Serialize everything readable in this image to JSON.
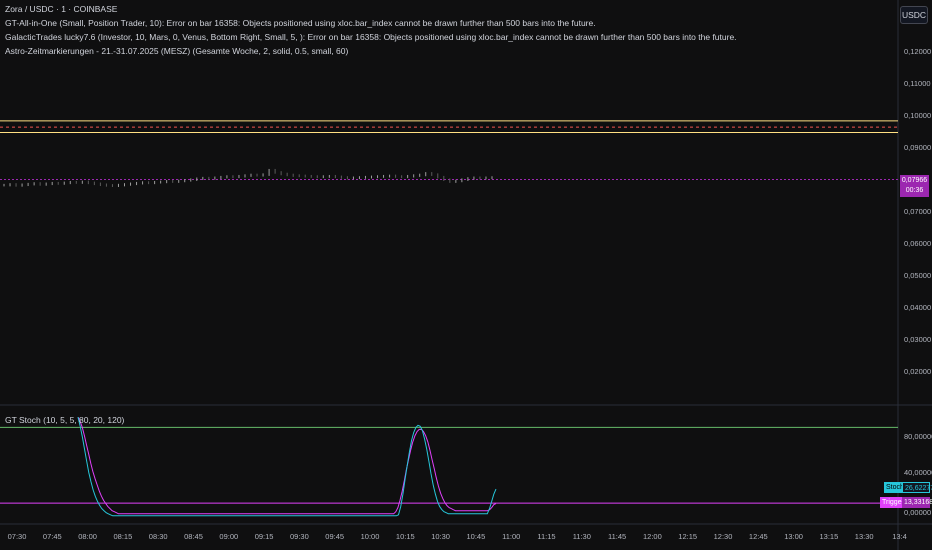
{
  "header": {
    "symbol_line": "Zora / USDC · 1 · COINBASE",
    "info_lines": [
      "GT-All-in-One (Small, Position Trader, 10): Error on bar 16358: Objects positioned using xloc.bar_index cannot be drawn further than 500 bars into the future.",
      "GalacticTrades lucky7.6 (Investor, 10, Mars, 0, Venus, Bottom Right, Small, 5, ): Error on bar 16358: Objects positioned using xloc.bar_index cannot be drawn further than 500 bars into the future.",
      "Astro-Zeitmarkierungen - 21.-31.07.2025 (MESZ) (Gesamte Woche, 2, solid, 0.5, small, 60)"
    ]
  },
  "currency_button": "USDC",
  "price_axis": {
    "labels": [
      "0,12000",
      "0,11000",
      "0,10000",
      "0,09000",
      "0,08000",
      "0,07000",
      "0,06000",
      "0,05000",
      "0,04000",
      "0,03000",
      "0,02000"
    ],
    "current_price": "0,07966",
    "countdown": "00:36"
  },
  "time_axis": {
    "labels": [
      "07:30",
      "07:45",
      "08:00",
      "08:15",
      "08:30",
      "08:45",
      "09:00",
      "09:15",
      "09:30",
      "09:45",
      "10:00",
      "10:15",
      "10:30",
      "10:45",
      "11:00",
      "11:15",
      "11:30",
      "11:45",
      "12:00",
      "12:15",
      "12:30",
      "12:45",
      "13:00",
      "13:15",
      "13:30",
      "13:4"
    ]
  },
  "indicator": {
    "title": "GT Stoch (10, 5, 5, 80, 20, 120)",
    "axis_labels": [
      "80,00000",
      "40,00000",
      "0,00000"
    ],
    "stoch_label": "Stoch",
    "stoch_value": "26,62277",
    "trigger_label": "Trigger",
    "trigger_value": "13,33168"
  },
  "colors": {
    "background": "#0f0f10",
    "upper_level": "#ffe082",
    "dashed_level": "#ef5350",
    "current_price": "#9c27b0",
    "stoch_line": "#26c6da",
    "trigger_line": "#e040fb",
    "overbought_line": "#66bb6a"
  },
  "chart_data": {
    "type": "candlestick",
    "price_ylim": [
      0.01,
      0.125
    ],
    "horizontal_levels": [
      0.0982,
      0.0962,
      0.0945
    ],
    "current_price": 0.07966,
    "close_series": [
      0.0779,
      0.0781,
      0.0778,
      0.078,
      0.0782,
      0.0784,
      0.0781,
      0.0783,
      0.0785,
      0.0784,
      0.0786,
      0.0788,
      0.0787,
      0.0789,
      0.0786,
      0.0783,
      0.078,
      0.0778,
      0.0777,
      0.0779,
      0.0781,
      0.0783,
      0.0785,
      0.0787,
      0.0786,
      0.0788,
      0.0789,
      0.0791,
      0.079,
      0.0792,
      0.0794,
      0.0796,
      0.0799,
      0.0801,
      0.08,
      0.0802,
      0.0804,
      0.0806,
      0.0805,
      0.0807,
      0.0809,
      0.0811,
      0.081,
      0.0812,
      0.0826,
      0.0819,
      0.0814,
      0.0811,
      0.0809,
      0.0808,
      0.0807,
      0.0806,
      0.0805,
      0.0806,
      0.0807,
      0.0805,
      0.0803,
      0.0801,
      0.0802,
      0.0803,
      0.0804,
      0.0805,
      0.0806,
      0.0807,
      0.0808,
      0.0806,
      0.0805,
      0.0807,
      0.0809,
      0.0811,
      0.0816,
      0.0812,
      0.0804,
      0.0796,
      0.079,
      0.0792,
      0.0796,
      0.08,
      0.0802,
      0.0801,
      0.0802,
      0.0803
    ],
    "stoch_ylim": [
      -5,
      100
    ],
    "overbought": 87,
    "oversold": 13.33,
    "stoch_series": [
      97,
      88,
      78,
      66,
      54,
      43,
      34,
      26,
      20,
      15,
      11,
      8,
      6,
      4,
      3,
      2,
      1,
      1,
      1,
      1,
      1,
      1,
      1,
      1,
      1,
      1,
      1,
      1,
      1,
      1,
      1,
      1,
      1,
      1,
      1,
      1,
      1,
      1,
      1,
      1,
      1,
      1,
      1,
      1,
      1,
      1,
      1,
      1,
      1,
      1,
      1,
      1,
      1,
      1,
      1,
      1,
      1,
      1,
      1,
      1,
      1,
      1,
      1,
      1,
      1,
      1,
      1,
      1,
      1,
      1,
      1,
      1,
      1,
      1,
      1,
      1,
      1,
      1,
      1,
      1,
      1,
      1,
      1,
      1,
      1,
      1,
      1,
      1,
      1,
      1,
      1,
      1,
      1,
      1,
      1,
      1,
      1,
      1,
      1,
      1,
      1,
      1,
      1,
      1,
      1,
      1,
      1,
      1,
      1,
      1,
      1,
      1,
      1,
      1,
      1,
      1,
      1,
      1,
      1,
      1,
      1,
      1,
      1,
      1,
      1,
      1,
      1,
      1,
      1,
      1,
      1,
      1,
      1,
      1,
      1,
      1,
      1,
      1,
      1,
      1,
      1,
      1,
      1,
      1,
      1,
      1,
      1,
      1,
      2,
      10,
      22,
      36,
      50,
      63,
      74,
      82,
      87,
      89,
      88,
      84,
      76,
      66,
      54,
      42,
      31,
      22,
      15,
      10,
      7,
      5,
      4,
      3,
      3,
      3,
      3,
      3,
      3,
      3,
      3,
      3,
      3,
      3,
      3,
      3,
      3,
      3,
      3,
      3,
      3,
      3,
      8,
      15,
      22,
      27
    ],
    "trigger_series": [
      97,
      93,
      87,
      79,
      70,
      61,
      52,
      44,
      37,
      31,
      25,
      20,
      16,
      13,
      10,
      8,
      6,
      5,
      4,
      3,
      3,
      3,
      3,
      3,
      3,
      3,
      3,
      3,
      3,
      3,
      3,
      3,
      3,
      3,
      3,
      3,
      3,
      3,
      3,
      3,
      3,
      3,
      3,
      3,
      3,
      3,
      3,
      3,
      3,
      3,
      3,
      3,
      3,
      3,
      3,
      3,
      3,
      3,
      3,
      3,
      3,
      3,
      3,
      3,
      3,
      3,
      3,
      3,
      3,
      3,
      3,
      3,
      3,
      3,
      3,
      3,
      3,
      3,
      3,
      3,
      3,
      3,
      3,
      3,
      3,
      3,
      3,
      3,
      3,
      3,
      3,
      3,
      3,
      3,
      3,
      3,
      3,
      3,
      3,
      3,
      3,
      3,
      3,
      3,
      3,
      3,
      3,
      3,
      3,
      3,
      3,
      3,
      3,
      3,
      3,
      3,
      3,
      3,
      3,
      3,
      3,
      3,
      3,
      3,
      3,
      3,
      3,
      3,
      3,
      3,
      3,
      3,
      3,
      3,
      3,
      3,
      3,
      3,
      3,
      3,
      3,
      3,
      3,
      3,
      3,
      3,
      3,
      3,
      3,
      5,
      9,
      16,
      25,
      35,
      46,
      56,
      65,
      73,
      79,
      83,
      85,
      85,
      83,
      79,
      73,
      65,
      56,
      47,
      38,
      30,
      23,
      18,
      14,
      11,
      9,
      8,
      7,
      6,
      6,
      6,
      6,
      6,
      6,
      6,
      6,
      6,
      6,
      6,
      6,
      6,
      6,
      6,
      6,
      7,
      9,
      12,
      13
    ]
  }
}
